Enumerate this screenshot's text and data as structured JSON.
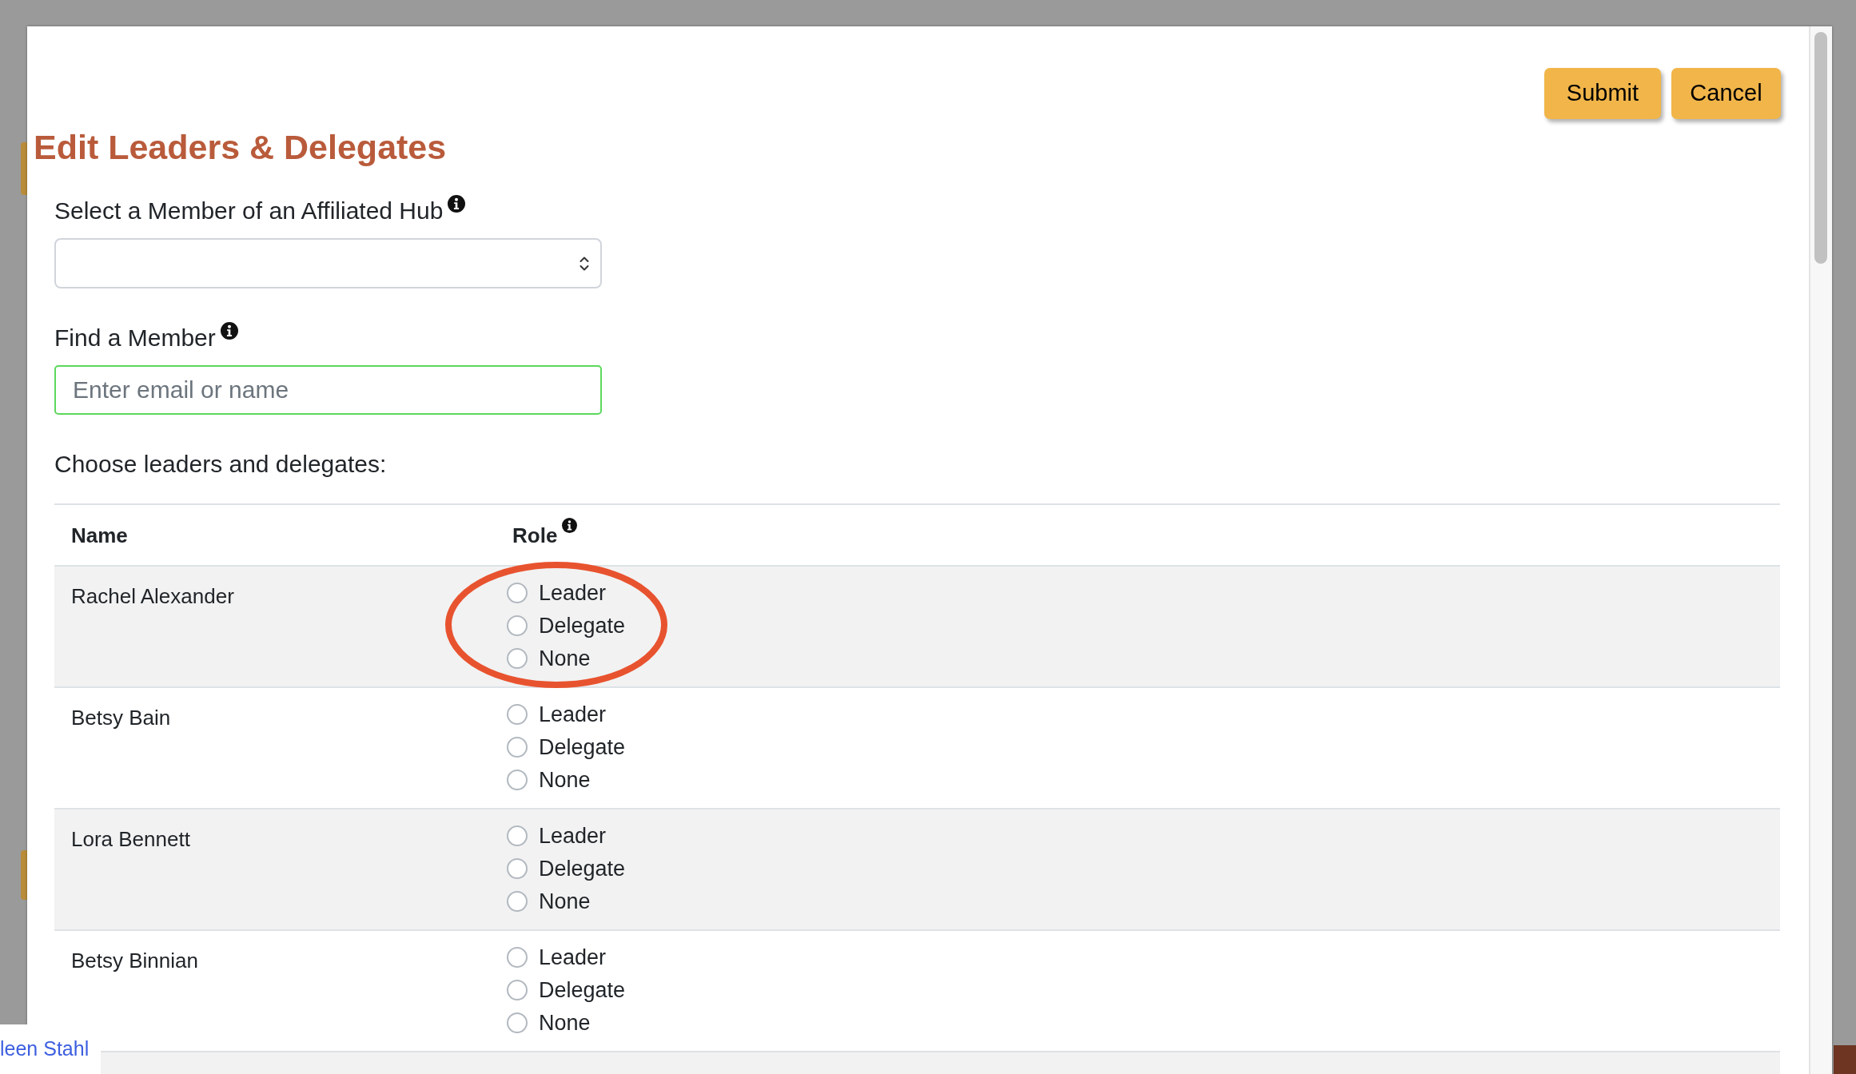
{
  "background_page": {
    "link_fragment": "leen Stahl"
  },
  "dialog": {
    "buttons": [
      "Submit",
      "Cancel"
    ],
    "title": "Edit Leaders & Delegates",
    "hub_select": {
      "label": "Select a Member of an Affiliated Hub",
      "info": true
    },
    "member_search": {
      "label": "Find a Member",
      "info": true,
      "placeholder": "Enter email or name",
      "focused": true
    },
    "instructions": "Choose leaders and delegates:",
    "table": {
      "columns": [
        {
          "label": "Name",
          "info": false
        },
        {
          "label": "Role",
          "info": true
        }
      ],
      "rows": [
        {
          "name": "Rachel Alexander",
          "highlighted": true,
          "options": [
            {
              "label": "Leader",
              "selected": false
            },
            {
              "label": "Delegate",
              "selected": false
            },
            {
              "label": "None",
              "selected": false
            }
          ]
        },
        {
          "name": "Betsy Bain",
          "highlighted": false,
          "options": [
            {
              "label": "Leader",
              "selected": false
            },
            {
              "label": "Delegate",
              "selected": false
            },
            {
              "label": "None",
              "selected": false
            }
          ]
        },
        {
          "name": "Lora Bennett",
          "highlighted": false,
          "options": [
            {
              "label": "Leader",
              "selected": false
            },
            {
              "label": "Delegate",
              "selected": false
            },
            {
              "label": "None",
              "selected": false
            }
          ]
        },
        {
          "name": "Betsy Binnian",
          "highlighted": false,
          "options": [
            {
              "label": "Leader",
              "selected": false
            },
            {
              "label": "Delegate",
              "selected": false
            },
            {
              "label": "None",
              "selected": false
            }
          ]
        }
      ]
    }
  }
}
